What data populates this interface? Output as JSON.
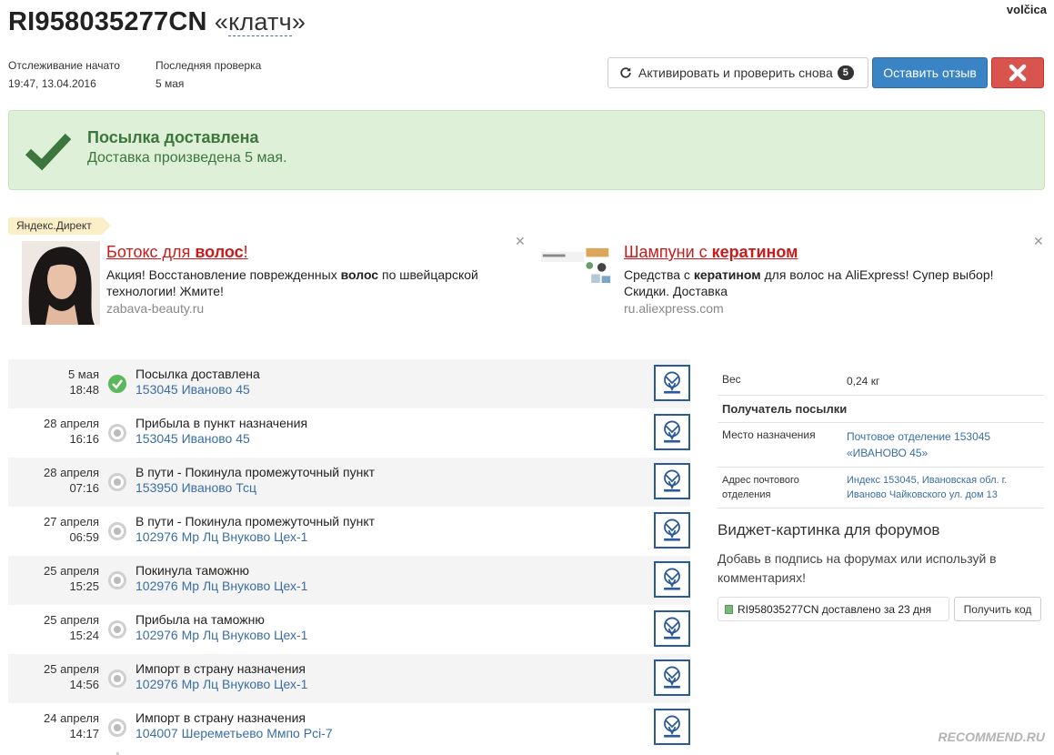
{
  "user": "volčica",
  "header": {
    "track_number": "RI958035277CN",
    "nickname": "клатч"
  },
  "meta": {
    "tracking_started_label": "Отслеживание начато",
    "tracking_started_value": "19:47, 13.04.2016",
    "last_check_label": "Последняя проверка",
    "last_check_value": "5 мая"
  },
  "toolbar": {
    "refresh_label": "Активировать и проверить снова",
    "refresh_count": "5",
    "review_label": "Оставить отзыв"
  },
  "alert": {
    "title": "Посылка доставлена",
    "text": "Доставка произведена 5 мая."
  },
  "ads": {
    "label": "Яндекс.Директ",
    "items": [
      {
        "title_pre": "Ботокс для ",
        "title_bold": "волос",
        "title_post": "!",
        "text_pre": "Акция! Восстановление поврежденных ",
        "text_bold": "волос",
        "text_post": " по швейцарской технологии! Жмите!",
        "host": "zabava-beauty.ru"
      },
      {
        "title_pre": "Шампуни с ",
        "title_bold": "кератином",
        "title_post": "",
        "text_pre": "Средства с ",
        "text_bold": "кератином",
        "text_post": " для волос на AliExpress! Супер выбор! Скидки. Доставка",
        "host": "ru.aliexpress.com"
      }
    ]
  },
  "events": [
    {
      "date": "5 мая",
      "time": "18:48",
      "status": "Посылка доставлена",
      "place": "153045 Иваново 45",
      "done": true
    },
    {
      "date": "28 апреля",
      "time": "16:16",
      "status": "Прибыла в пункт назначения",
      "place": "153045 Иваново 45",
      "done": false
    },
    {
      "date": "28 апреля",
      "time": "07:16",
      "status": "В пути - Покинула промежуточный пункт",
      "place": "153950 Иваново Тсц",
      "done": false
    },
    {
      "date": "27 апреля",
      "time": "06:59",
      "status": "В пути - Покинула промежуточный пункт",
      "place": "102976 Мр Лц Внуково Цех-1",
      "done": false
    },
    {
      "date": "25 апреля",
      "time": "15:25",
      "status": "Покинула таможню",
      "place": "102976 Мр Лц Внуково Цех-1",
      "done": false
    },
    {
      "date": "25 апреля",
      "time": "15:24",
      "status": "Прибыла на таможню",
      "place": "102976 Мр Лц Внуково Цех-1",
      "done": false
    },
    {
      "date": "25 апреля",
      "time": "14:56",
      "status": "Импорт в страну назначения",
      "place": "102976 Мр Лц Внуково Цех-1",
      "done": false
    },
    {
      "date": "24 апреля",
      "time": "14:17",
      "status": "Импорт в страну назначения",
      "place": "104007 Шереметьево Ммпо Pci-7",
      "done": false
    }
  ],
  "info": {
    "weight_label": "Вес",
    "weight_value": "0,24 кг",
    "recipient_heading": "Получатель посылки",
    "destination_label": "Место назначения",
    "destination_value": "Почтовое отделение 153045 «ИВАНОВО 45»",
    "address_label": "Адрес почтового отделения",
    "address_value": "Индекс 153045, Ивановская обл. г. Иваново Чайковского ул. дом 13"
  },
  "widget": {
    "title": "Виджет-картинка для форумов",
    "text": "Добавь в подпись на форумах или используй в комментариях!",
    "preview": "RI958035277CN доставлено за 23 дня",
    "button": "Получить код"
  },
  "watermark": "RECOMMEND.RU",
  "colors": {
    "primary": "#3a84c6",
    "danger": "#d9534f",
    "success_bg": "#dff0d8",
    "success_text": "#3c763d",
    "link": "#3a6ea5",
    "ad_title": "#cc1a1a"
  }
}
